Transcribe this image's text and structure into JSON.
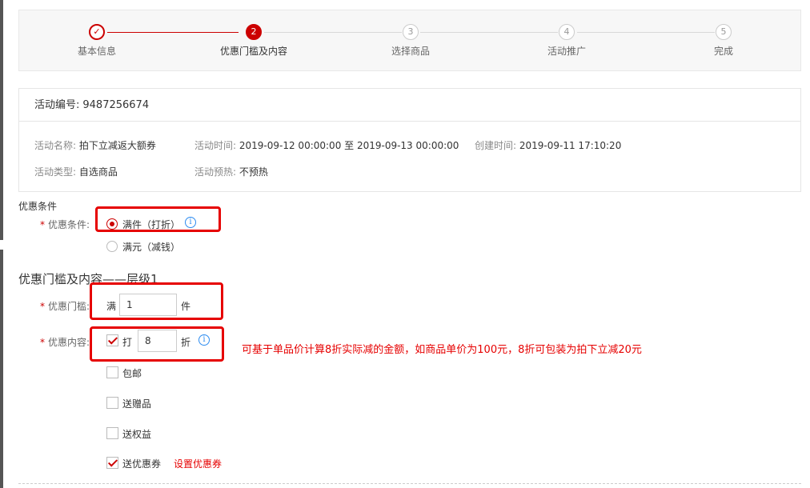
{
  "steps": [
    {
      "num": "✓",
      "label": "基本信息",
      "state": "done"
    },
    {
      "num": "2",
      "label": "优惠门槛及内容",
      "state": "active"
    },
    {
      "num": "3",
      "label": "选择商品",
      "state": "pending"
    },
    {
      "num": "4",
      "label": "活动推广",
      "state": "pending"
    },
    {
      "num": "5",
      "label": "完成",
      "state": "pending"
    }
  ],
  "info": {
    "id_label": "活动编号:",
    "id_value": "9487256674",
    "name_label": "活动名称:",
    "name_value": "拍下立减返大额券",
    "time_label": "活动时间:",
    "time_value": "2019-09-12 00:00:00 至 2019-09-13 00:00:00",
    "created_label": "创建时间:",
    "created_value": "2019-09-11 17:10:20",
    "type_label": "活动类型:",
    "type_value": "自选商品",
    "preheat_label": "活动预热:",
    "preheat_value": "不预热"
  },
  "condition": {
    "section_title": "优惠条件",
    "label": "优惠条件:",
    "option1": "满件（打折）",
    "option2": "满元（减钱）",
    "selected": "满件（打折）"
  },
  "tier": {
    "title": "优惠门槛及内容——层级1",
    "threshold_label": "优惠门槛:",
    "threshold_prefix": "满",
    "threshold_value": "1",
    "threshold_unit": "件",
    "content_label": "优惠内容:",
    "discount_label": "打",
    "discount_value": "8",
    "discount_unit": "折",
    "free_shipping": "包邮",
    "gift": "送赠品",
    "rights": "送权益",
    "coupon": "送优惠券",
    "coupon_link": "设置优惠券"
  },
  "annotation": "可基于单品价计算8折实际减的金额，如商品单价为100元，8折可包装为拍下立减20元",
  "colors": {
    "accent": "#cc0000",
    "annotation": "#e60000",
    "info_icon": "#2d8cf0"
  }
}
